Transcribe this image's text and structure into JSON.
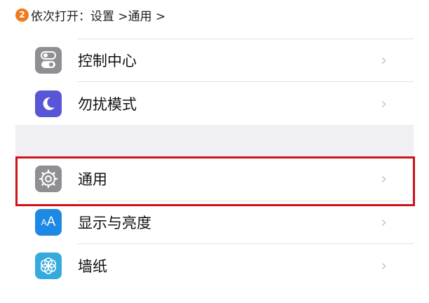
{
  "step": {
    "number": "2",
    "text": "依次打开：设置 >通用 >"
  },
  "settings": {
    "group1": [
      {
        "label": "控制中心",
        "icon": "control-center-icon",
        "color": "#8e8e93"
      },
      {
        "label": "勿扰模式",
        "icon": "moon-icon",
        "color": "#5856d6"
      }
    ],
    "group2": [
      {
        "label": "通用",
        "icon": "gear-icon",
        "color": "#8e8e93",
        "highlighted": true
      },
      {
        "label": "显示与亮度",
        "icon": "text-size-icon",
        "color": "#1e88e5"
      },
      {
        "label": "墙纸",
        "icon": "flower-icon",
        "color": "#35aadc"
      }
    ]
  },
  "colors": {
    "highlight": "#d0121b",
    "step_badge": "#f07a1c"
  }
}
